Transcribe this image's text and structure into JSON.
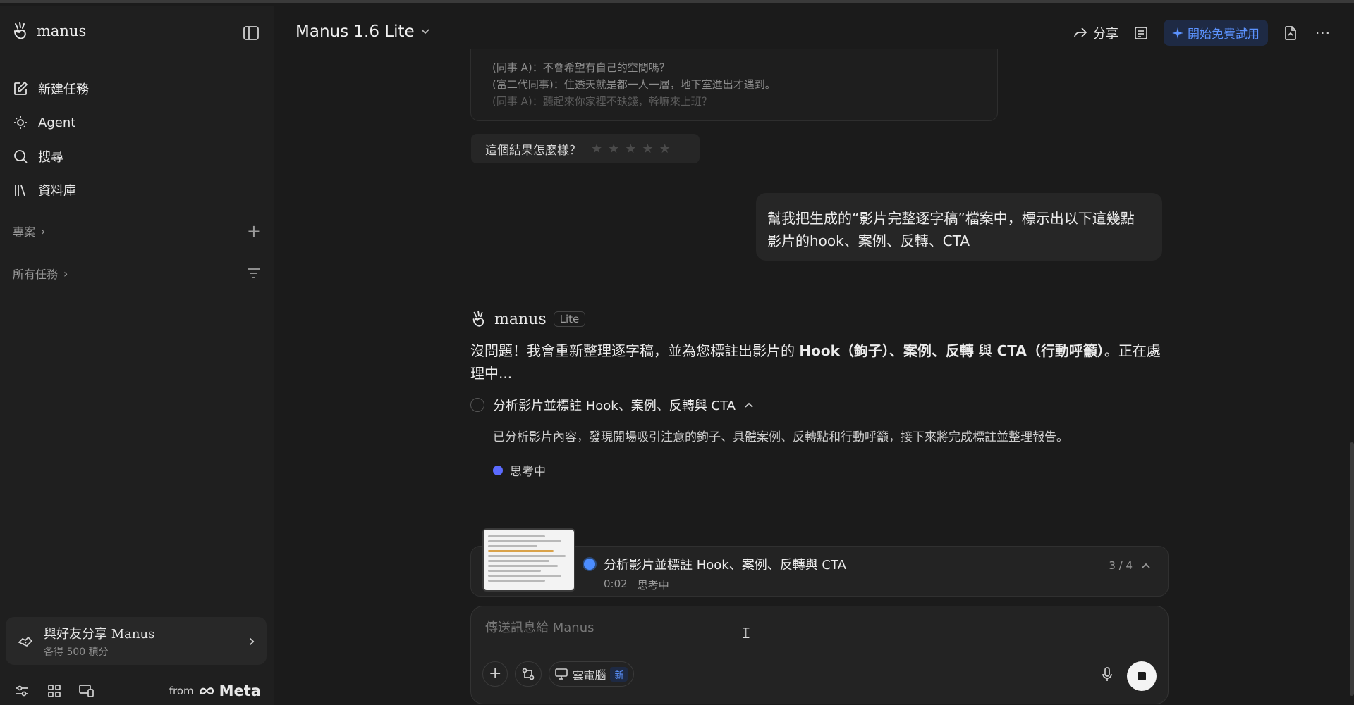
{
  "sidebar": {
    "brand": "manus",
    "nav": [
      {
        "label": "新建任務",
        "icon": "edit-icon"
      },
      {
        "label": "Agent",
        "icon": "agent-icon"
      },
      {
        "label": "搜尋",
        "icon": "search-icon"
      },
      {
        "label": "資料庫",
        "icon": "library-icon"
      }
    ],
    "projects_label": "專案",
    "all_tasks_label": "所有任務",
    "share_card": {
      "title": "與好友分享 Manus",
      "subtitle": "各得 500 積分"
    },
    "footer": {
      "from": "from",
      "meta": "Meta"
    }
  },
  "topbar": {
    "model": "Manus 1.6 Lite",
    "share": "分享",
    "trial": "開始免費試用"
  },
  "conversation": {
    "quote_lines": [
      "(同事 A)：不會希望有自己的空間嗎？",
      "(富二代同事)：住透天就是都一人一層，地下室進出才遇到。",
      "(同事 A)：聽起來你家裡不缺錢，幹嘛來上班？"
    ],
    "rating_prompt": "這個結果怎麼樣？",
    "rating_stars": 5,
    "user_message_line1": "幫我把生成的“影片完整逐字稿”檔案中，標示出以下這幾點",
    "user_message_line2": "影片的hook、案例、反轉、CTA",
    "agent_name": "manus",
    "agent_badge": "Lite",
    "agent_reply": {
      "p1": "沒問題！我會重新整理逐字稿，並為您標註出影片的 ",
      "b1": "Hook（鉤子）",
      "p2": "、",
      "b2": "案例",
      "p3": "、",
      "b3": "反轉",
      "p4": " 與 ",
      "b4": "CTA（行動呼籲）",
      "p5": "。正在處理中..."
    },
    "task": {
      "title": "分析影片並標註 Hook、案例、反轉與 CTA",
      "description": "已分析影片內容，發現開場吸引注意的鉤子、具體案例、反轉點和行動呼籲，接下來將完成標註並整理報告。",
      "status": "思考中"
    }
  },
  "status_card": {
    "title": "分析影片並標註 Hook、案例、反轉與 CTA",
    "elapsed": "0:02",
    "status": "思考中",
    "progress": "3 / 4"
  },
  "composer": {
    "placeholder": "傳送訊息給 Manus",
    "cloud_pc": "雲電腦",
    "new_badge": "新"
  },
  "colors": {
    "accent": "#5c93ff",
    "thinking_dot": "#5b6bff"
  }
}
